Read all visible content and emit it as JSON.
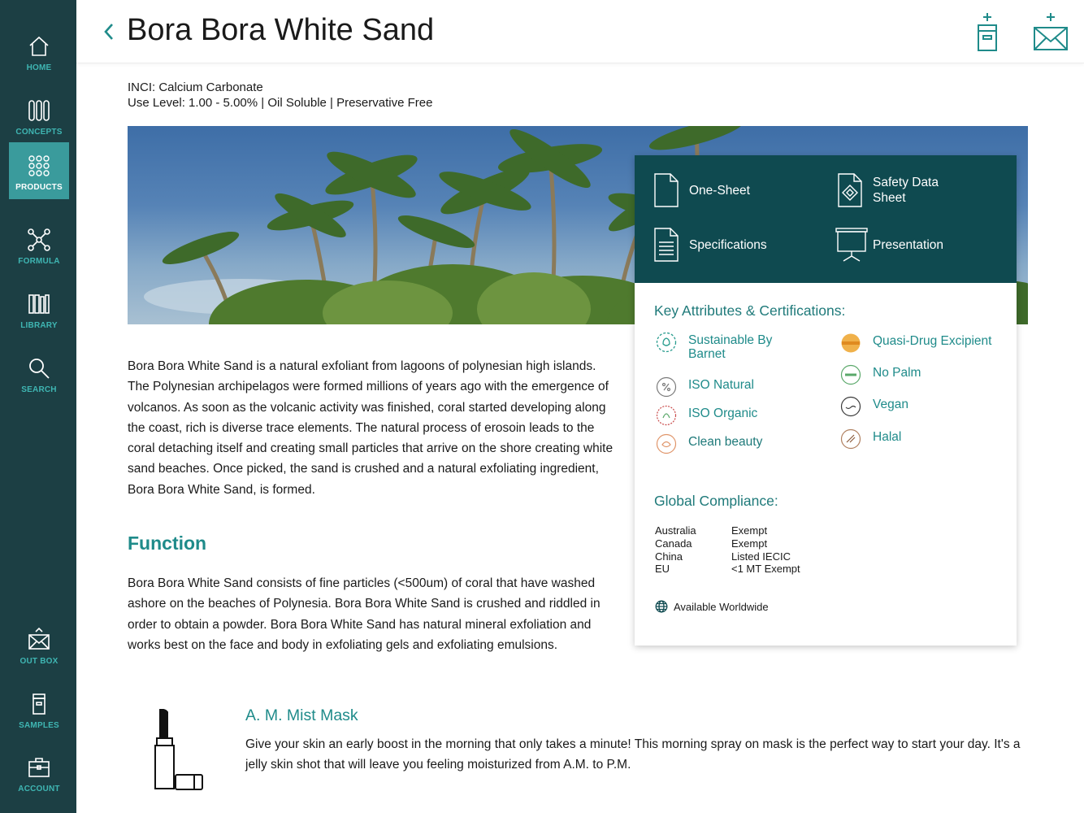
{
  "sidebar": {
    "items": [
      {
        "label": "HOME",
        "icon": "home-icon"
      },
      {
        "label": "CONCEPTS",
        "icon": "concepts-icon"
      },
      {
        "label": "PRODUCTS",
        "icon": "products-icon",
        "active": true
      },
      {
        "label": "FORMULA",
        "icon": "formula-icon"
      },
      {
        "label": "LIBRARY",
        "icon": "library-icon"
      },
      {
        "label": "SEARCH",
        "icon": "search-icon"
      }
    ],
    "bottom_items": [
      {
        "label": "OUT BOX",
        "icon": "outbox-icon"
      },
      {
        "label": "SAMPLES",
        "icon": "samples-icon"
      },
      {
        "label": "ACCOUNT",
        "icon": "account-icon"
      }
    ]
  },
  "header": {
    "title": "Bora Bora White Sand",
    "actions": [
      "add-sample-icon",
      "add-to-outbox-icon"
    ]
  },
  "product": {
    "inci": "INCI: Calcium Carbonate",
    "use_level": "Use Level: 1.00 - 5.00%  |  Oil Soluble  | Preservative Free",
    "description": "Bora Bora White Sand is a natural exfoliant from lagoons of polynesian high islands. The Polynesian archipelagos were formed millions of years ago with the emergence of volcanos. As soon as the volcanic activity was finished, coral started developing along the coast, rich is diverse trace elements. The natural process of erosoin leads to the coral detaching itself and creating small particles that arrive on the shore creating white sand beaches. Once picked, the sand is crushed and a natural exfoliating ingredient, Bora Bora White Sand, is formed.",
    "function_title": "Function",
    "function_text": "Bora Bora White Sand consists of fine particles (<500um) of coral that have washed ashore on the beaches of Polynesia. Bora Bora White Sand is crushed and riddled in order to obtain a powder. Bora Bora White Sand has natural mineral exfoliation and works best on the face and body in exfoliating gels and exfoliating emulsions."
  },
  "documents": [
    {
      "label": "One-Sheet",
      "icon": "document-icon"
    },
    {
      "label": "Safety Data Sheet",
      "icon": "safety-data-sheet-icon"
    },
    {
      "label": "Specifications",
      "icon": "specifications-icon"
    },
    {
      "label": "Presentation",
      "icon": "presentation-icon"
    }
  ],
  "attributes": {
    "title": "Key Attributes & Certifications:",
    "left": [
      {
        "label": "Sustainable By Barnet",
        "icon": "sustainable-badge-icon",
        "color": "#2a9d8f"
      },
      {
        "label": "ISO Natural",
        "icon": "iso-natural-badge-icon",
        "color": "#7a7a7a"
      },
      {
        "label": "ISO Organic",
        "icon": "iso-organic-badge-icon",
        "color": "#c94a4a"
      },
      {
        "label": "Clean beauty",
        "icon": "clean-beauty-badge-icon",
        "color": "#e0956a"
      }
    ],
    "right": [
      {
        "label": "Quasi-Drug Excipient",
        "icon": "quasi-drug-badge-icon",
        "color": "#e8a23a"
      },
      {
        "label": "No Palm",
        "icon": "no-palm-badge-icon",
        "color": "#5aa86a"
      },
      {
        "label": "Vegan",
        "icon": "vegan-badge-icon",
        "color": "#3a3a3a"
      },
      {
        "label": "Halal",
        "icon": "halal-badge-icon",
        "color": "#b08060"
      }
    ]
  },
  "compliance": {
    "title": "Global Compliance:",
    "rows": [
      {
        "country": "Australia",
        "status": "Exempt"
      },
      {
        "country": "Canada",
        "status": "Exempt"
      },
      {
        "country": "China",
        "status": "Listed IECIC"
      },
      {
        "country": "EU",
        "status": "<1 MT Exempt"
      }
    ],
    "worldwide": "Available Worldwide"
  },
  "concept": {
    "title": "A. M. Mist Mask",
    "text": "Give your skin an early boost in the morning that only takes a minute! This morning spray on mask is the perfect way to start your day. It's a jelly skin shot that will leave you feeling moisturized from A.M. to P.M.",
    "icon": "lipstick-icon"
  },
  "colors": {
    "sidebar": "#1c3f44",
    "accent": "#3fb6b3",
    "active": "#3a9b9c",
    "docs_bg": "#0f4a50",
    "teal_text": "#1f8b8a"
  }
}
